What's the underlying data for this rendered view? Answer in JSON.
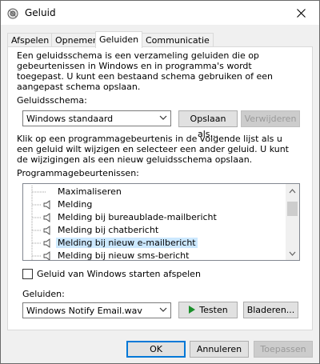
{
  "window": {
    "title": "Geluid"
  },
  "tabs": [
    {
      "label": "Afspelen"
    },
    {
      "label": "Opnemen"
    },
    {
      "label": "Geluiden"
    },
    {
      "label": "Communicatie"
    }
  ],
  "intro_text": "Een geluidsschema is een verzameling geluiden die op gebeurtenissen in Windows en in programma's wordt toegepast.  U kunt een bestaand schema gebruiken of een aangepast schema opslaan.",
  "scheme": {
    "label": "Geluidsschema:",
    "selected": "Windows standaard",
    "save_label": "Opslaan als...",
    "delete_label": "Verwijderen"
  },
  "instruction_text": "Klik op een programmagebeurtenis in de volgende lijst als u een geluid wilt wijzigen en selecteer een ander geluid. U kunt de wijzigingen als een nieuw geluidsschema opslaan.",
  "events": {
    "label": "Programmagebeurtenissen:",
    "items": [
      {
        "label": "Maximaliseren",
        "has_sound": false,
        "selected": false
      },
      {
        "label": "Melding",
        "has_sound": true,
        "selected": false
      },
      {
        "label": "Melding bij bureaublade-mailbericht",
        "has_sound": true,
        "selected": false
      },
      {
        "label": "Melding bij chatbericht",
        "has_sound": true,
        "selected": false
      },
      {
        "label": "Melding bij nieuw e-mailbericht",
        "has_sound": true,
        "selected": true
      },
      {
        "label": "Melding bij nieuw sms-bericht",
        "has_sound": true,
        "selected": false
      }
    ]
  },
  "startup_checkbox": {
    "label": "Geluid van Windows starten afspelen",
    "checked": false
  },
  "sounds": {
    "label": "Geluiden:",
    "selected": "Windows Notify Email.wav",
    "test_label": "Testen",
    "browse_label": "Bladeren..."
  },
  "footer": {
    "ok_label": "OK",
    "cancel_label": "Annuleren",
    "apply_label": "Toepassen"
  }
}
